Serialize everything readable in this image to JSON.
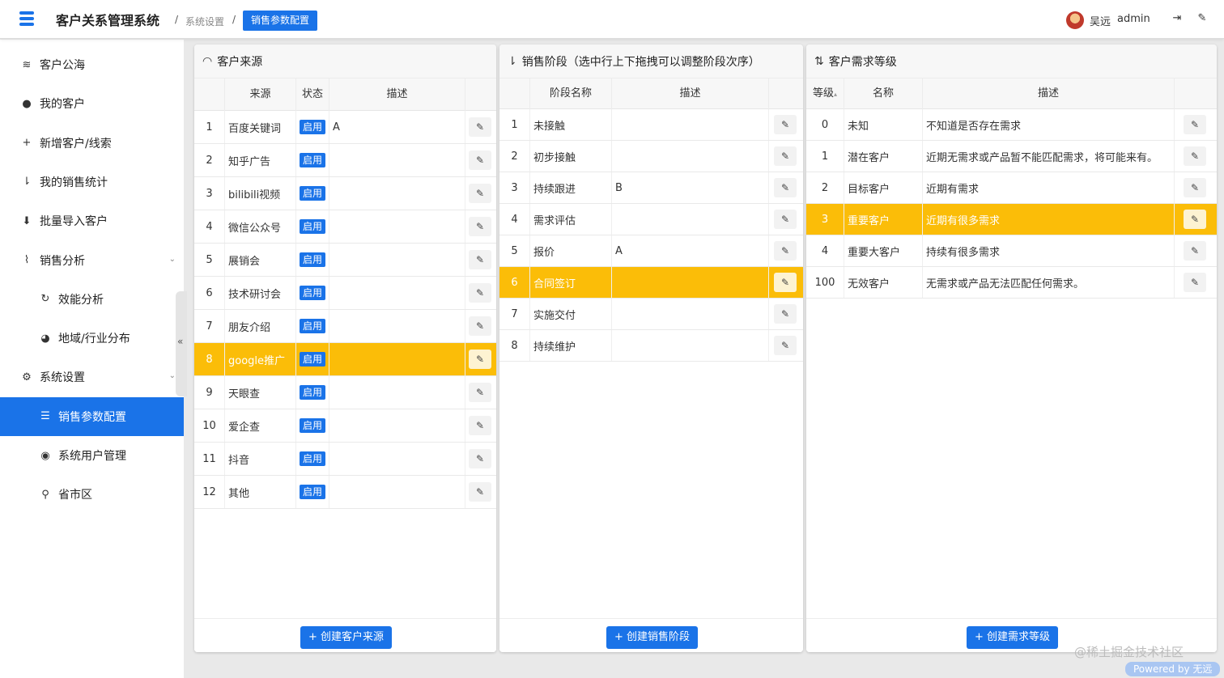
{
  "app": {
    "title": "客户关系管理系统",
    "accent": "#1a73e8",
    "highlight": "#fbbd08",
    "breadcrumb": {
      "sep": "/",
      "parent": "系统设置",
      "current": "销售参数配置"
    }
  },
  "user": {
    "name": "吴远",
    "login": "admin",
    "icons": [
      "logout-icon",
      "brush-icon"
    ]
  },
  "sidebar": {
    "collapse_glyph": "«",
    "items": [
      {
        "label": "客户公海",
        "icon": "waves-icon",
        "glyph": "≋"
      },
      {
        "label": "我的客户",
        "icon": "user-icon",
        "glyph": "●"
      },
      {
        "label": "新增客户/线索",
        "icon": "plus-icon",
        "glyph": "+"
      },
      {
        "label": "我的销售统计",
        "icon": "sort-icon",
        "glyph": "⇂"
      },
      {
        "label": "批量导入客户",
        "icon": "import-icon",
        "glyph": "⬇"
      },
      {
        "label": "销售分析",
        "icon": "chart-icon",
        "glyph": "⌇",
        "chevron": "⌄"
      },
      {
        "label": "效能分析",
        "icon": "refresh-icon",
        "glyph": "↻"
      },
      {
        "label": "地域/行业分布",
        "icon": "pie-icon",
        "glyph": "◕"
      },
      {
        "label": "系统设置",
        "icon": "cogs-icon",
        "glyph": "⚙",
        "chevron": "⌄"
      },
      {
        "label": "销售参数配置",
        "icon": "sliders-icon",
        "glyph": "☰",
        "active": true
      },
      {
        "label": "系统用户管理",
        "icon": "users-icon",
        "glyph": "◉"
      },
      {
        "label": "省市区",
        "icon": "pin-icon",
        "glyph": "⚲"
      }
    ]
  },
  "sources": {
    "title": "客户来源",
    "icon_glyph": "◠",
    "columns": [
      "",
      "来源",
      "状态",
      "描述",
      ""
    ],
    "edit_glyph": "✎",
    "rows": [
      {
        "no": "1",
        "name": "百度关键词",
        "status": "启用",
        "desc": "A"
      },
      {
        "no": "2",
        "name": "知乎广告",
        "status": "启用",
        "desc": ""
      },
      {
        "no": "3",
        "name": "bilibili视频",
        "status": "启用",
        "desc": ""
      },
      {
        "no": "4",
        "name": "微信公众号",
        "status": "启用",
        "desc": ""
      },
      {
        "no": "5",
        "name": "展销会",
        "status": "启用",
        "desc": ""
      },
      {
        "no": "6",
        "name": "技术研讨会",
        "status": "启用",
        "desc": ""
      },
      {
        "no": "7",
        "name": "朋友介绍",
        "status": "启用",
        "desc": ""
      },
      {
        "no": "8",
        "name": "google推广",
        "status": "启用",
        "desc": "",
        "selected": true
      },
      {
        "no": "9",
        "name": "天眼查",
        "status": "启用",
        "desc": ""
      },
      {
        "no": "10",
        "name": "爱企查",
        "status": "启用",
        "desc": ""
      },
      {
        "no": "11",
        "name": "抖音",
        "status": "启用",
        "desc": ""
      },
      {
        "no": "12",
        "name": "其他",
        "status": "启用",
        "desc": ""
      }
    ],
    "create_label": "+ 创建客户来源"
  },
  "stages": {
    "title": "销售阶段（选中行上下拖拽可以调整阶段次序）",
    "icon_glyph": "⇂",
    "columns": [
      "",
      "阶段名称",
      "描述",
      ""
    ],
    "edit_glyph": "✎",
    "rows": [
      {
        "no": "1",
        "name": "未接触",
        "desc": ""
      },
      {
        "no": "2",
        "name": "初步接触",
        "desc": ""
      },
      {
        "no": "3",
        "name": "持续跟进",
        "desc": "B"
      },
      {
        "no": "4",
        "name": "需求评估",
        "desc": ""
      },
      {
        "no": "5",
        "name": "报价",
        "desc": "A"
      },
      {
        "no": "6",
        "name": "合同签订",
        "desc": "",
        "selected": true
      },
      {
        "no": "7",
        "name": "实施交付",
        "desc": ""
      },
      {
        "no": "8",
        "name": "持续维护",
        "desc": ""
      }
    ],
    "create_label": "+ 创建销售阶段"
  },
  "levels": {
    "title": "客户需求等级",
    "icon_glyph": "⇅",
    "columns": [
      "等级",
      "名称",
      "描述",
      ""
    ],
    "sort_glyph": "▴",
    "edit_glyph": "✎",
    "rows": [
      {
        "no": "0",
        "name": "未知",
        "desc": "不知道是否存在需求"
      },
      {
        "no": "1",
        "name": "潜在客户",
        "desc": "近期无需求或产品暂不能匹配需求，将可能来有。"
      },
      {
        "no": "2",
        "name": "目标客户",
        "desc": "近期有需求"
      },
      {
        "no": "3",
        "name": "重要客户",
        "desc": "近期有很多需求",
        "selected": true
      },
      {
        "no": "4",
        "name": "重要大客户",
        "desc": "持续有很多需求"
      },
      {
        "no": "100",
        "name": "无效客户",
        "desc": "无需求或产品无法匹配任何需求。"
      }
    ],
    "create_label": "+ 创建需求等级"
  },
  "footer": {
    "watermark": "@稀土掘金技术社区",
    "powered": "Powered by 无远"
  }
}
